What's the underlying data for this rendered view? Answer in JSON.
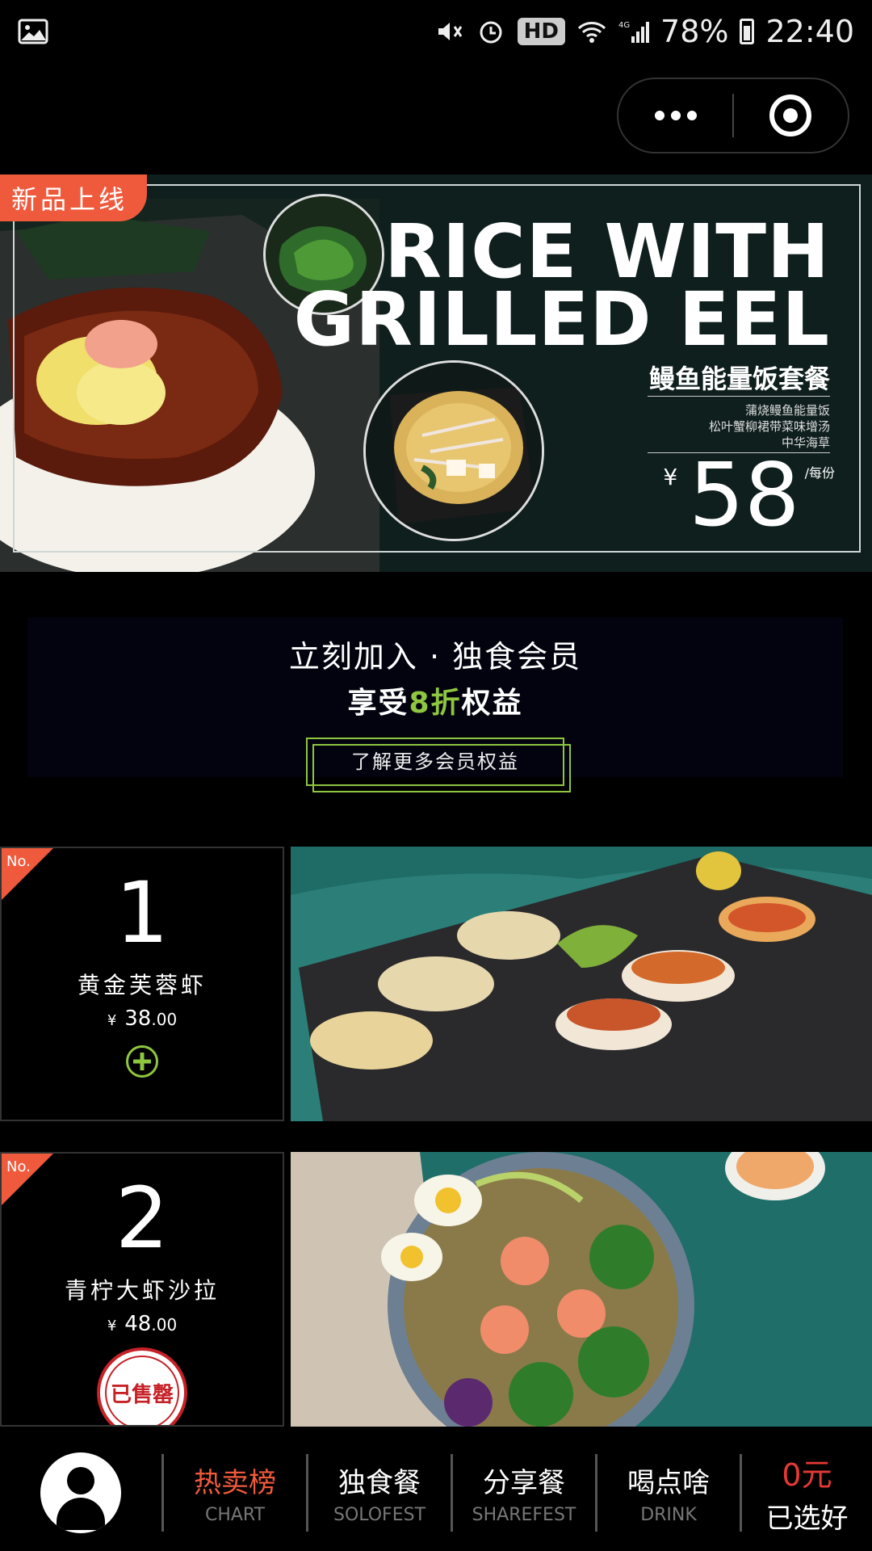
{
  "status_bar": {
    "hd_label": "HD",
    "network_label": "4G",
    "battery": "78%",
    "time": "22:40",
    "icons": [
      "image-icon",
      "mute-icon",
      "alarm-icon",
      "wifi-icon",
      "signal-icon",
      "battery-icon"
    ]
  },
  "capsule": {
    "menu_icon": "more-dots-icon",
    "close_icon": "target-icon"
  },
  "banner": {
    "tag": "新品上线",
    "title_line1": "RICE WITH",
    "title_line2": "GRILLED EEL",
    "subtitle": "鳗鱼能量饭套餐",
    "items": [
      "蒲烧鳗鱼能量饭",
      "松叶蟹柳裙带菜味增汤",
      "中华海草"
    ],
    "price_symbol": "¥",
    "price": "58",
    "price_unit": "/每份"
  },
  "member": {
    "line1": "立刻加入 · 独食会员",
    "line2_prefix": "享受",
    "line2_highlight": "8折",
    "line2_suffix": "权益",
    "button_label": "了解更多会员权益"
  },
  "products": [
    {
      "no_label": "No.",
      "rank": "1",
      "name": "黄金芙蓉虾",
      "currency": "¥",
      "price_int": "38",
      "price_dec": ".00",
      "action": "add"
    },
    {
      "no_label": "No.",
      "rank": "2",
      "name": "青柠大虾沙拉",
      "currency": "¥",
      "price_int": "48",
      "price_dec": ".00",
      "action": "sold_out",
      "sold_out_label": "已售罄"
    }
  ],
  "tabbar": {
    "tabs": [
      {
        "cn": "热卖榜",
        "en": "CHART",
        "active": true
      },
      {
        "cn": "独食餐",
        "en": "SOLOFEST",
        "active": false
      },
      {
        "cn": "分享餐",
        "en": "SHAREFEST",
        "active": false
      },
      {
        "cn": "喝点啥",
        "en": "DRINK",
        "active": false
      }
    ],
    "cart_amount": "0元",
    "cart_label": "已选好"
  },
  "colors": {
    "accent": "#ef5a3c",
    "green": "#8ec63f",
    "price_red": "#e53935"
  }
}
